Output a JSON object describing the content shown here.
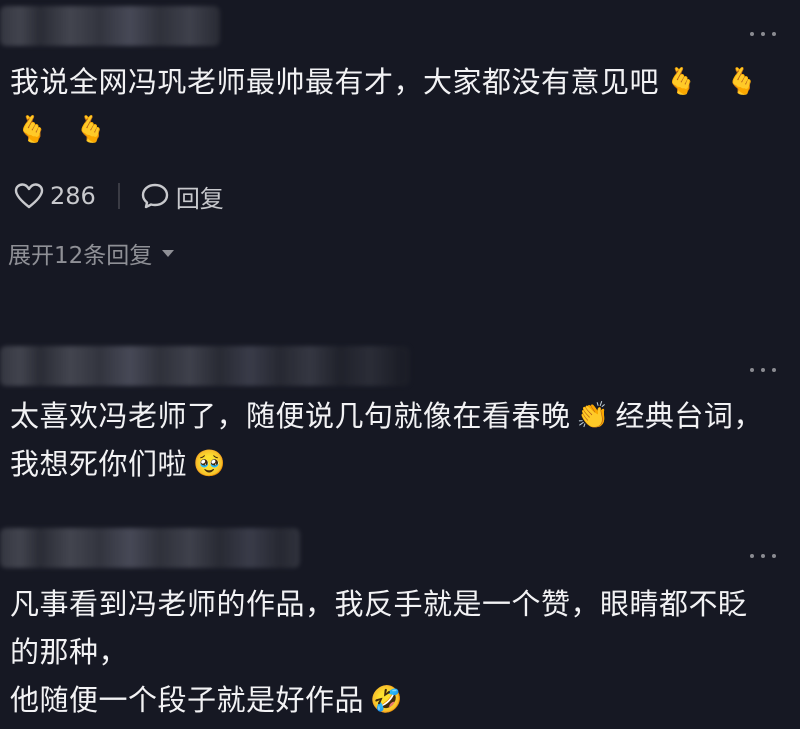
{
  "comments": [
    {
      "text_line1": "我说全网冯巩老师最帅最有才，大家都没有意见吧",
      "emoji_1": "🫰",
      "emoji_2": "🫰",
      "emoji_3": "🫰",
      "emoji_4": "🫰",
      "like_count": "286",
      "reply_label": "回复",
      "expand_replies_label": "展开12条回复"
    },
    {
      "text_line1": "太喜欢冯老师了，随便说几句就像在看春晚",
      "emoji_clap": "👏",
      "text_line1b": "经典台词，",
      "text_line2": "我想死你们啦",
      "emoji_face": "🥹"
    },
    {
      "text_line1": "凡事看到冯老师的作品，我反手就是一个赞，眼睛都不眨",
      "text_line2": "的那种，",
      "text_line3": "他随便一个段子就是好作品",
      "emoji_laugh": "🤣"
    }
  ],
  "icons": {
    "like": "heart-outline-icon",
    "reply": "speech-bubble-icon",
    "more": "more-dots-icon",
    "expand": "chevron-down-icon"
  },
  "colors": {
    "background": "#161823",
    "text_primary": "#f2f2f4",
    "text_secondary": "#8f9096",
    "action_text": "#c8c9cd"
  }
}
